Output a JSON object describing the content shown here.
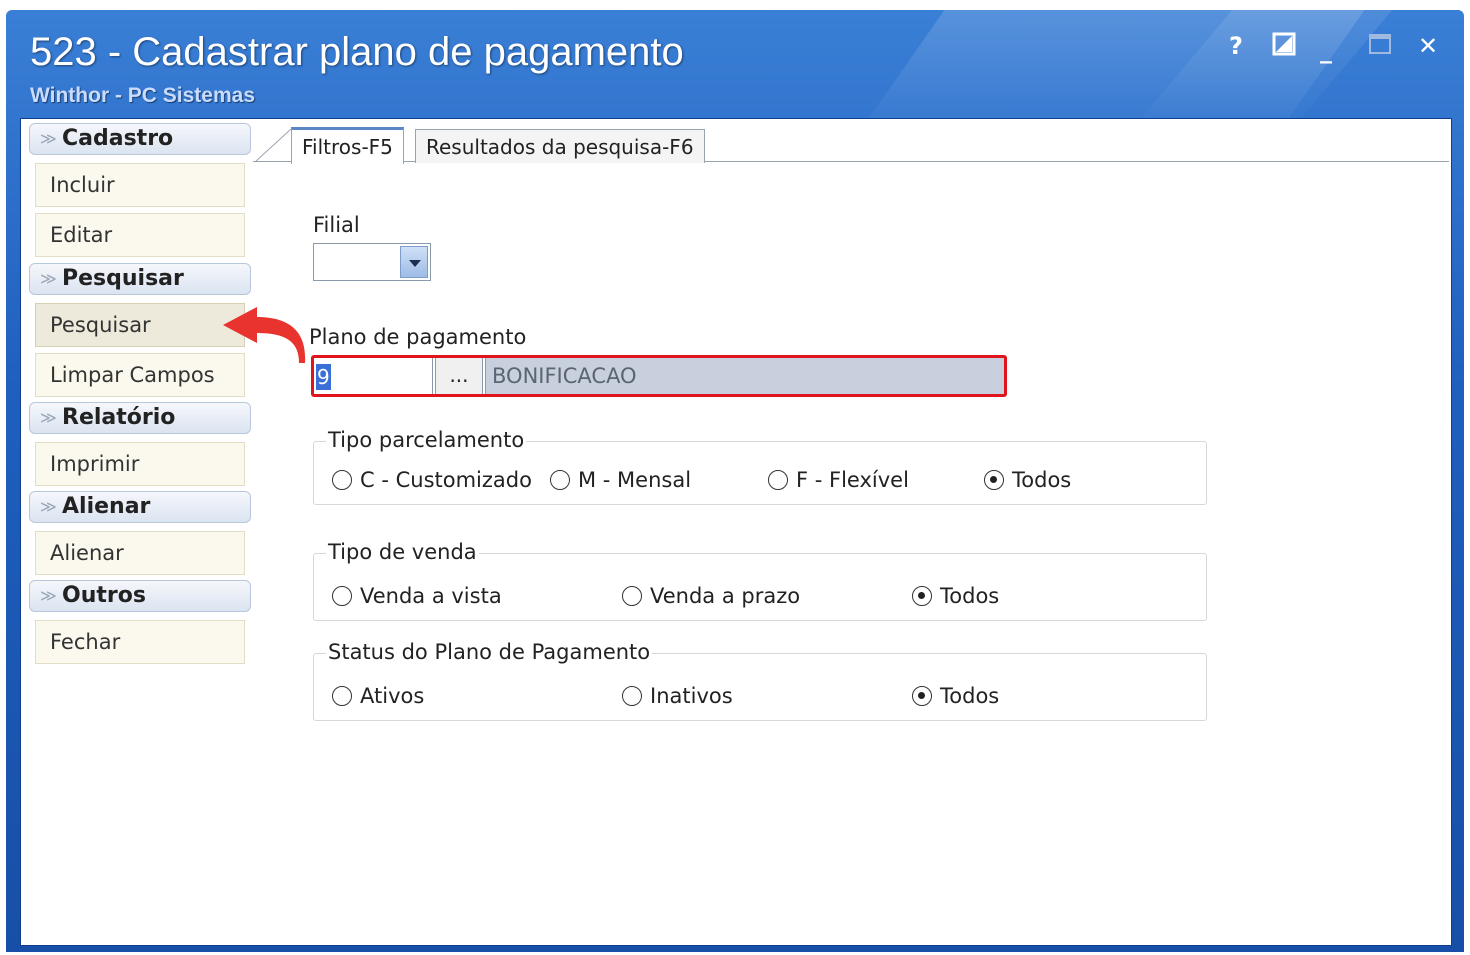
{
  "window": {
    "title": "523 - Cadastrar plano de pagamento",
    "subtitle": "Winthor - PC Sistemas",
    "controls": {
      "help": "?",
      "restore": "◪",
      "minimize": "_",
      "maximize": "□",
      "close": "✕"
    }
  },
  "sidebar": {
    "groups": [
      {
        "header": "Cadastro",
        "items": [
          "Incluir",
          "Editar"
        ]
      },
      {
        "header": "Pesquisar",
        "items": [
          "Pesquisar",
          "Limpar Campos"
        ]
      },
      {
        "header": "Relatório",
        "items": [
          "Imprimir"
        ]
      },
      {
        "header": "Alienar",
        "items": [
          "Alienar"
        ]
      },
      {
        "header": "Outros",
        "items": [
          "Fechar"
        ]
      }
    ]
  },
  "tabs": [
    "Filtros-F5",
    "Resultados da pesquisa-F6"
  ],
  "filters": {
    "filial_label": "Filial",
    "filial_value": "",
    "plano_label": "Plano de pagamento",
    "plano_code": "9",
    "plano_lookup": "...",
    "plano_desc": "BONIFICACAO",
    "tipo_parcelamento": {
      "legend": "Tipo parcelamento",
      "options": [
        "C - Customizado",
        "M - Mensal",
        "F - Flexível",
        "Todos"
      ],
      "selected": "Todos"
    },
    "tipo_venda": {
      "legend": "Tipo de venda",
      "options": [
        "Venda a vista",
        "Venda a prazo",
        "Todos"
      ],
      "selected": "Todos"
    },
    "status": {
      "legend": "Status do Plano de Pagamento",
      "options": [
        "Ativos",
        "Inativos",
        "Todos"
      ],
      "selected": "Todos"
    }
  },
  "colors": {
    "highlight": "#e0141c",
    "annotation_arrow": "#e8332f",
    "title_bar": "#1f5fbe"
  }
}
